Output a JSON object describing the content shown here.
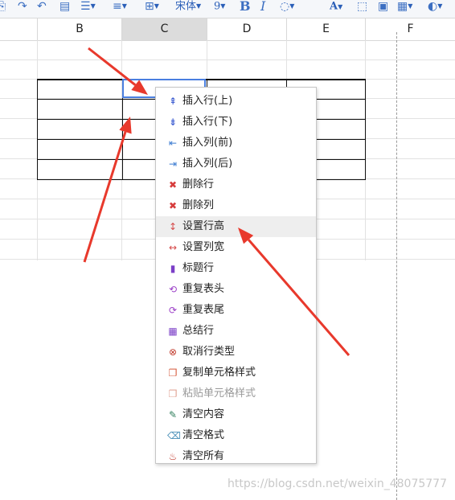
{
  "toolbar": {
    "font_name": "宋体",
    "font_size": "9",
    "bold": "B",
    "italic": "I",
    "font_color": "A"
  },
  "columns": [
    "B",
    "C",
    "D",
    "E",
    "F"
  ],
  "selected_column": "C",
  "context_menu": {
    "items": [
      {
        "label": "插入行(上)",
        "icon": "insert-row-above-icon",
        "color": "#3b5bd1"
      },
      {
        "label": "插入行(下)",
        "icon": "insert-row-below-icon",
        "color": "#3b5bd1"
      },
      {
        "label": "插入列(前)",
        "icon": "insert-column-before-icon",
        "color": "#3b7bd1"
      },
      {
        "label": "插入列(后)",
        "icon": "insert-column-after-icon",
        "color": "#3b7bd1"
      },
      {
        "label": "删除行",
        "icon": "delete-row-icon",
        "color": "#d63c3c"
      },
      {
        "label": "删除列",
        "icon": "delete-column-icon",
        "color": "#d63c3c"
      },
      {
        "label": "设置行高",
        "icon": "row-height-icon",
        "color": "#d64a4a"
      },
      {
        "label": "设置列宽",
        "icon": "column-width-icon",
        "color": "#d64a4a"
      },
      {
        "label": "标题行",
        "icon": "bookmark-icon",
        "color": "#7b3fc7"
      },
      {
        "label": "重复表头",
        "icon": "repeat-header-icon",
        "color": "#9b3fc7"
      },
      {
        "label": "重复表尾",
        "icon": "repeat-footer-icon",
        "color": "#9b3fc7"
      },
      {
        "label": "总结行",
        "icon": "summary-grid-icon",
        "color": "#7b3fc7"
      },
      {
        "label": "取消行类型",
        "icon": "cancel-circle-icon",
        "color": "#c0392b"
      },
      {
        "label": "复制单元格样式",
        "icon": "copy-style-icon",
        "color": "#d65a3c"
      },
      {
        "label": "粘贴单元格样式",
        "icon": "paste-style-icon",
        "color": "#e0a090",
        "disabled": true
      },
      {
        "label": "清空内容",
        "icon": "brush-icon",
        "color": "#2e7d5b"
      },
      {
        "label": "清空格式",
        "icon": "clear-format-icon",
        "color": "#4a90b8"
      },
      {
        "label": "清空所有",
        "icon": "clear-all-icon",
        "color": "#c0392b"
      }
    ],
    "hover_index": 6
  },
  "annotation_color": "#e8392c",
  "watermark": "https://blog.csdn.net/weixin_48075777"
}
